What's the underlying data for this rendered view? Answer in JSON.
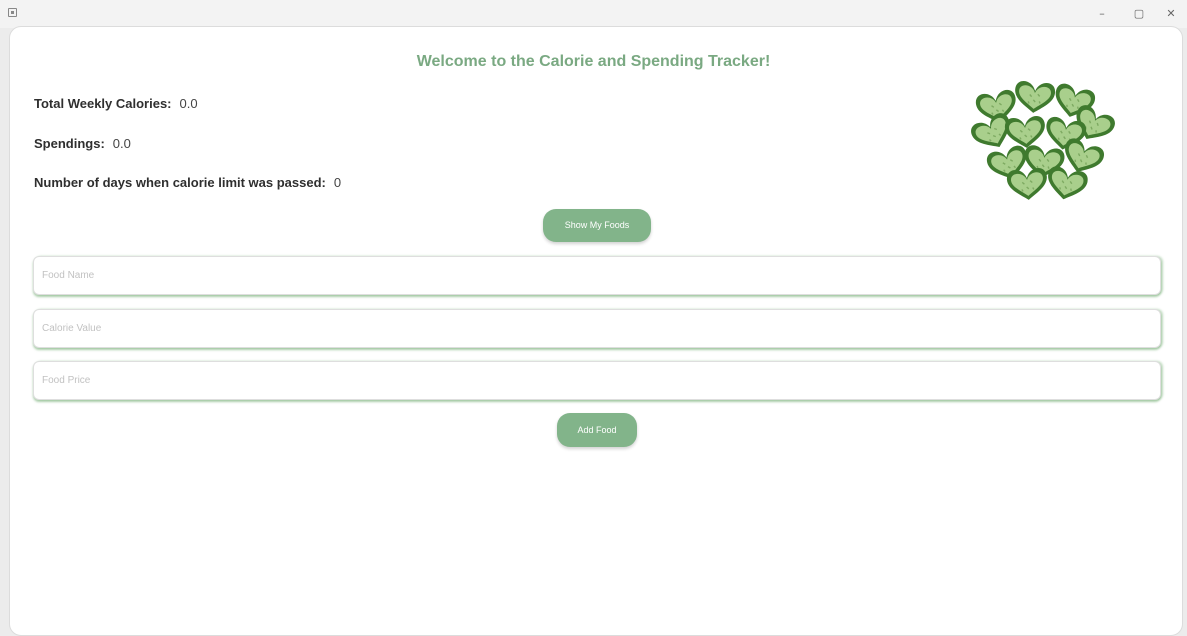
{
  "window": {
    "minimize_glyph": "–",
    "maximize_glyph": "▢",
    "close_glyph": "✕"
  },
  "header": {
    "welcome": "Welcome to the Calorie and Spending Tracker!"
  },
  "stats": {
    "calories_label": "Total Weekly Calories:",
    "calories_value": "0.0",
    "spendings_label": "Spendings:",
    "spendings_value": "0.0",
    "days_label": "Number of days when calorie limit was passed:",
    "days_value": "0"
  },
  "buttons": {
    "show_foods": "Show My Foods",
    "add_food": "Add Food"
  },
  "form": {
    "food_name_placeholder": "Food Name",
    "calorie_value_placeholder": "Calorie Value",
    "food_price_placeholder": "Food Price"
  },
  "colors": {
    "accent": "#82b48a",
    "title": "#7aa982",
    "cucumber_skin": "#3f7a2e",
    "cucumber_flesh": "#a9cf8c"
  },
  "image": {
    "icon": "cucumber-hearts-image"
  }
}
